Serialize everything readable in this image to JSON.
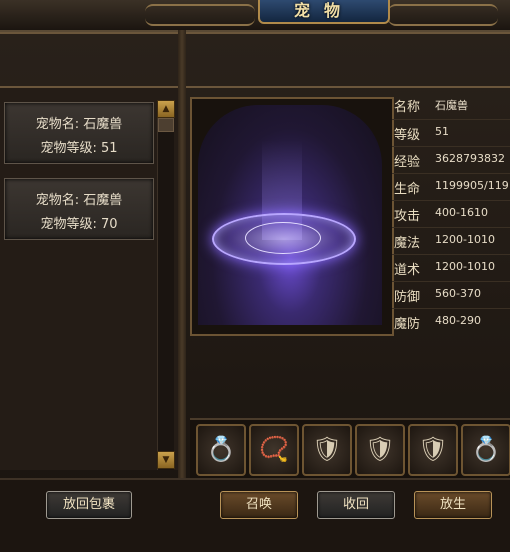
{
  "window": {
    "title": "宠物"
  },
  "pet_list": [
    {
      "name_label": "宠物名: 石魔兽",
      "level_label": "宠物等级: 51"
    },
    {
      "name_label": "宠物名: 石魔兽",
      "level_label": "宠物等级: 70"
    }
  ],
  "scroll": {
    "up_icon": "▲",
    "down_icon": "▼"
  },
  "stats": [
    {
      "label": "名称",
      "value": "石魔兽"
    },
    {
      "label": "等级",
      "value": "51"
    },
    {
      "label": "经验",
      "value": "3628793832"
    },
    {
      "label": "生命",
      "value": "1199905/119"
    },
    {
      "label": "攻击",
      "value": "400-1610"
    },
    {
      "label": "魔法",
      "value": "1200-1010"
    },
    {
      "label": "道术",
      "value": "1200-1010"
    },
    {
      "label": "防御",
      "value": "560-370"
    },
    {
      "label": "魔防",
      "value": "480-290"
    }
  ],
  "equipment": [
    {
      "icon": "bracelet-icon",
      "glyph": "💍"
    },
    {
      "icon": "necklace-icon",
      "glyph": "📿"
    },
    {
      "icon": "armor-icon",
      "glyph": "🛡"
    },
    {
      "icon": "armor-icon",
      "glyph": "🛡"
    },
    {
      "icon": "armor-icon",
      "glyph": "🛡"
    },
    {
      "icon": "ring-icon",
      "glyph": "💍"
    }
  ],
  "buttons": {
    "put_back": "放回包裹",
    "summon": "召唤",
    "recall": "收回",
    "release": "放生"
  },
  "colors": {
    "accent": "#b89358",
    "title_plate": "#1e3a5f"
  }
}
